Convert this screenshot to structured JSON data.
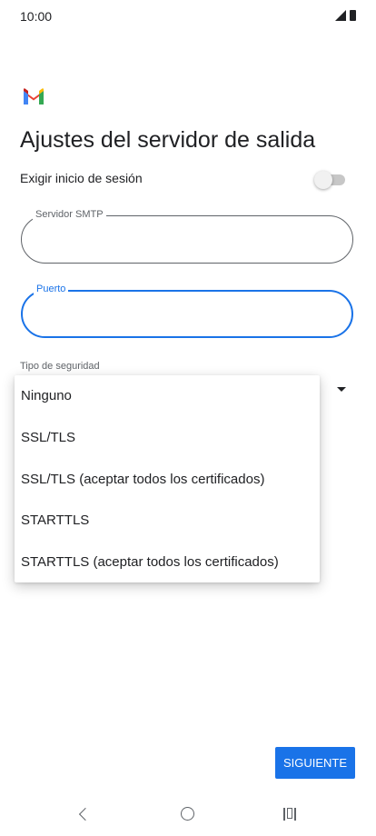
{
  "status_bar": {
    "time": "10:00"
  },
  "header": {
    "title": "Ajustes del servidor de salida"
  },
  "login_toggle": {
    "label": "Exigir inicio de sesión",
    "on": false
  },
  "smtp_field": {
    "label": "Servidor SMTP",
    "value": ""
  },
  "port_field": {
    "label": "Puerto",
    "value": ""
  },
  "security": {
    "label": "Tipo de seguridad",
    "options": [
      "Ninguno",
      "SSL/TLS",
      "SSL/TLS (aceptar todos los certificados)",
      "STARTTLS",
      "STARTTLS (aceptar todos los certificados)"
    ]
  },
  "footer": {
    "next_label": "SIGUIENTE"
  },
  "colors": {
    "accent": "#1a73e8",
    "text": "#202124",
    "muted": "#5f6368"
  },
  "icons": {
    "logo": "gmail-logo-icon",
    "signal": "signal-icon",
    "battery": "battery-icon",
    "dropdown": "dropdown-arrow-icon",
    "back": "back-icon",
    "home": "home-icon",
    "recents": "recents-icon"
  }
}
